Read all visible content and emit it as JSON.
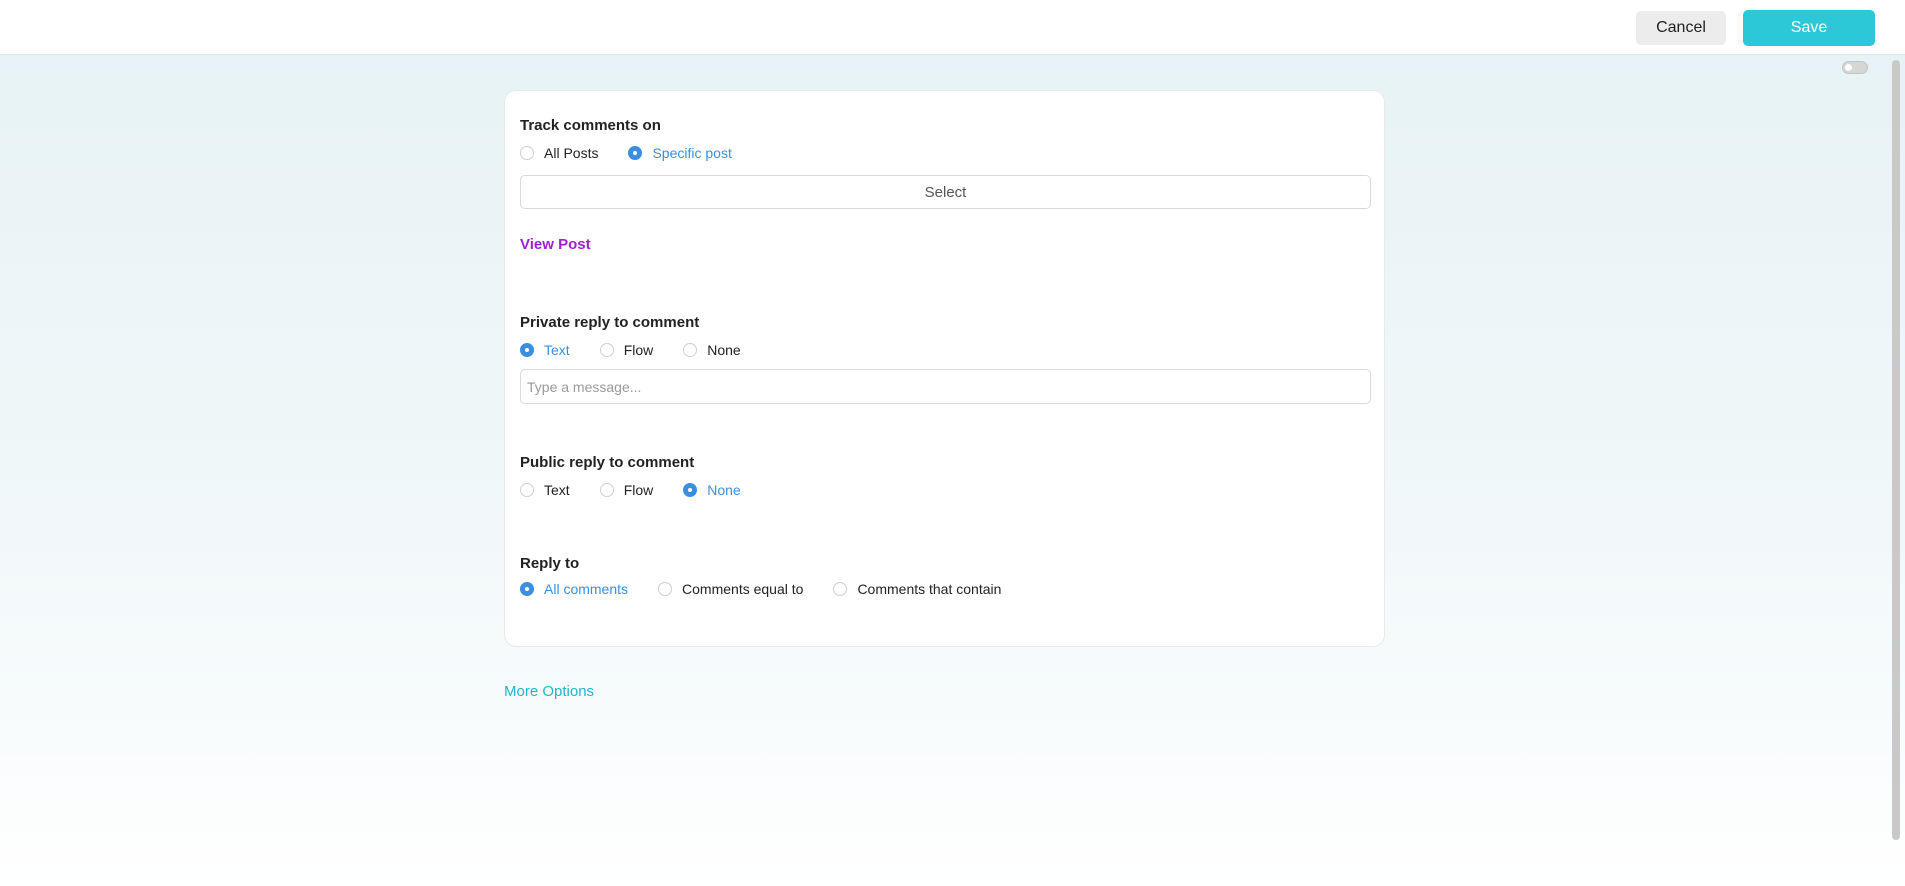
{
  "toolbar": {
    "cancel_label": "Cancel",
    "save_label": "Save"
  },
  "track": {
    "title": "Track comments on",
    "options": [
      {
        "label": "All Posts",
        "checked": false
      },
      {
        "label": "Specific post",
        "checked": true
      }
    ],
    "select_label": "Select",
    "view_post_label": "View Post"
  },
  "private_reply": {
    "title": "Private reply to comment",
    "options": [
      {
        "label": "Text",
        "checked": true
      },
      {
        "label": "Flow",
        "checked": false
      },
      {
        "label": "None",
        "checked": false
      }
    ],
    "message_placeholder": "Type a message..."
  },
  "public_reply": {
    "title": "Public reply to comment",
    "options": [
      {
        "label": "Text",
        "checked": false
      },
      {
        "label": "Flow",
        "checked": false
      },
      {
        "label": "None",
        "checked": true
      }
    ]
  },
  "reply_to": {
    "title": "Reply to",
    "options": [
      {
        "label": "All comments",
        "checked": true
      },
      {
        "label": "Comments equal to",
        "checked": false
      },
      {
        "label": "Comments that contain",
        "checked": false
      }
    ]
  },
  "more_options_label": "More Options",
  "colors": {
    "accent": "#2cc8d8",
    "radio_checked": "#3a8fe0",
    "view_post": "#a21fd0"
  }
}
